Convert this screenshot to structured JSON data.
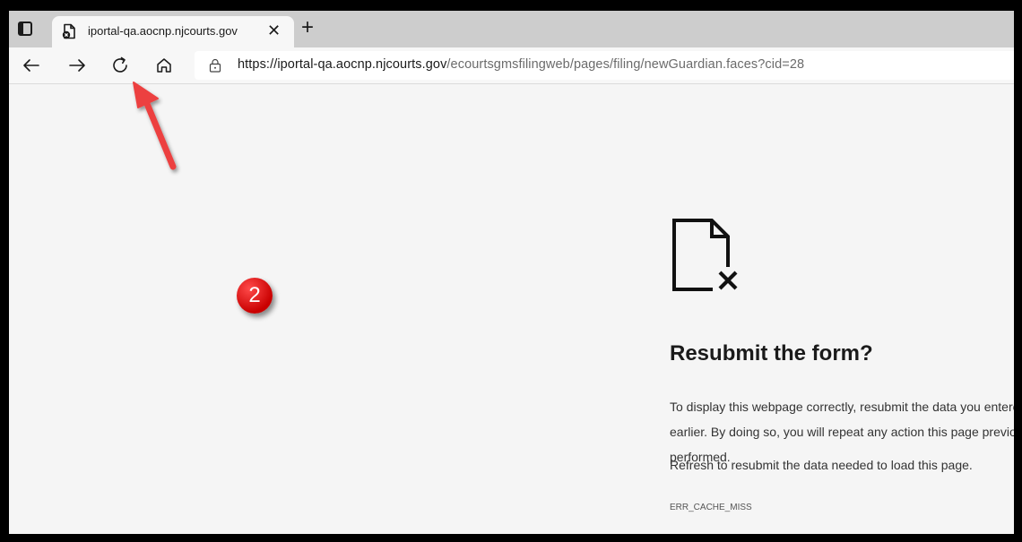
{
  "browser": {
    "tab": {
      "title": "iportal-qa.aocnp.njcourts.gov",
      "close_glyph": "✕",
      "favicon": "page-error-icon"
    },
    "new_tab_glyph": "+",
    "toolbar": {
      "back_icon": "back-arrow-icon",
      "forward_icon": "forward-arrow-icon",
      "refresh_icon": "refresh-icon",
      "home_icon": "home-icon"
    },
    "address_bar": {
      "url_host": "https://iportal-qa.aocnp.njcourts.gov",
      "url_path": "/ecourtsgmsfilingweb/pages/filing/newGuardian.faces?cid=28",
      "lock_icon": "lock-icon"
    }
  },
  "error_page": {
    "icon": "document-error-icon",
    "title": "Resubmit the form?",
    "description": "To display this webpage correctly, resubmit the data you entered earlier. By doing so, you will repeat any action this page previously performed.",
    "refresh_hint": "Refresh to resubmit the data needed to load this page.",
    "error_code": "ERR_CACHE_MISS"
  },
  "annotations": {
    "step_number": "2",
    "arrow_color": "#ec4141",
    "badge_color": "#d40000"
  }
}
